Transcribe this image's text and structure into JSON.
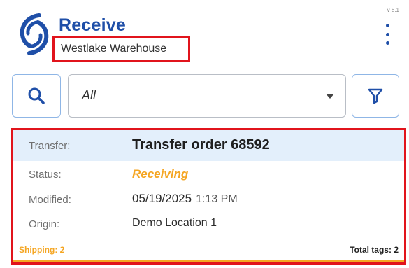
{
  "header": {
    "title": "Receive",
    "warehouse": "Westlake Warehouse",
    "version": "v 8.1",
    "brand_color": "#1f4fa8"
  },
  "icons": {
    "logo": "company-logo",
    "menu": "more-vert-icon",
    "search": "search-icon",
    "filter": "filter-icon",
    "dropdown": "chevron-down-icon"
  },
  "toolbar": {
    "filter_select_value": "All"
  },
  "card": {
    "transfer_label": "Transfer:",
    "transfer_value": "Transfer order 68592",
    "status_label": "Status:",
    "status_value": "Receiving",
    "status_color": "#f5a623",
    "modified_label": "Modified:",
    "modified_date": "05/19/2025",
    "modified_time": "1:13 PM",
    "origin_label": "Origin:",
    "origin_value": "Demo Location 1",
    "shipping_label": "Shipping: 2",
    "total_tags_label": "Total tags: 2",
    "progress_percent": 100
  },
  "highlight_color": "#e1141c"
}
